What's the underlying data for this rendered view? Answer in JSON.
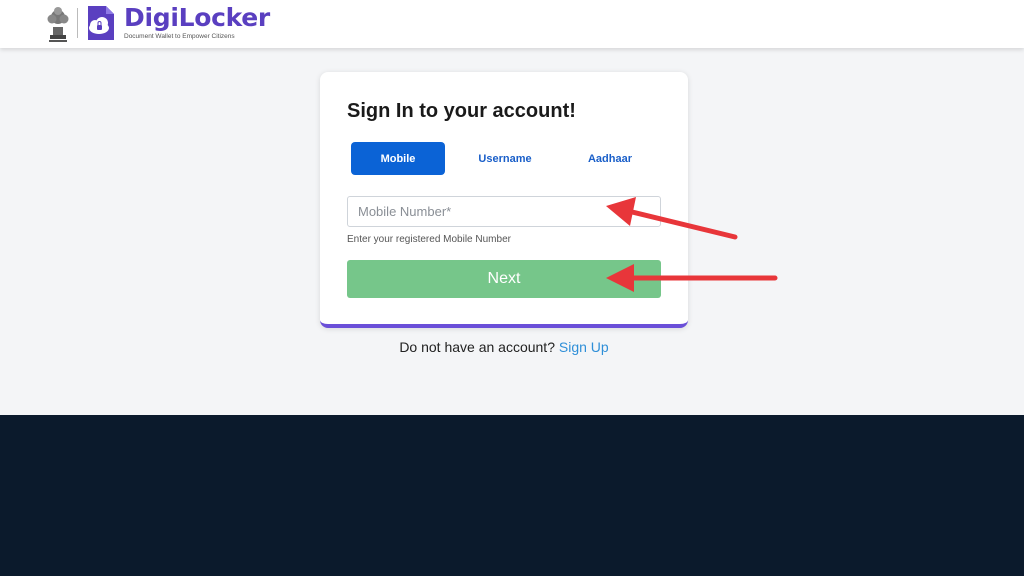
{
  "header": {
    "brand_name": "DigiLocker",
    "tagline": "Document Wallet to Empower Citizens"
  },
  "login": {
    "title": "Sign In to your account!",
    "tabs": [
      {
        "label": "Mobile",
        "active": true
      },
      {
        "label": "Username",
        "active": false
      },
      {
        "label": "Aadhaar",
        "active": false
      }
    ],
    "mobile_placeholder": "Mobile Number*",
    "mobile_value": "",
    "helper_text": "Enter your registered Mobile Number",
    "next_label": "Next"
  },
  "signup": {
    "prompt": "Do not have an account?",
    "link_label": "Sign Up"
  },
  "colors": {
    "brand": "#5a3fc0",
    "active_tab": "#0b63d6",
    "next_button": "#76c68a",
    "card_accent": "#6a4fd8",
    "footer": "#0b1a2c",
    "annotation_arrow": "#e8363a"
  },
  "icons": {
    "emblem": "national-emblem-icon",
    "logo": "digilocker-cloud-lock-icon"
  }
}
